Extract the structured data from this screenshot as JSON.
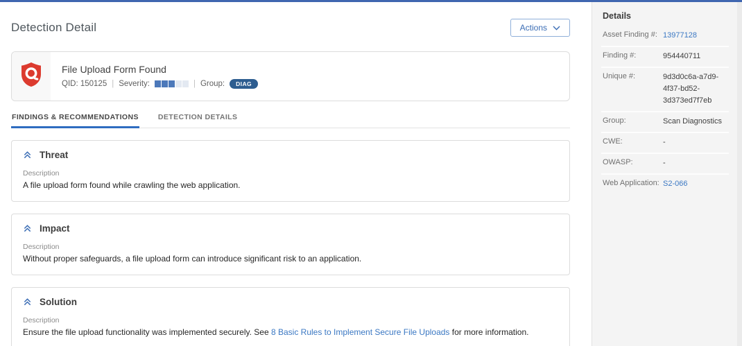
{
  "colors": {
    "accent": "#2f6cc0",
    "accent_dark": "#3f66b0",
    "severity_filled": "#4d79ba",
    "badge": "#2d5d90",
    "link": "#3b78c3",
    "logo_red": "#dc3b2f"
  },
  "page": {
    "title": "Detection Detail",
    "actions_label": "Actions"
  },
  "finding_header": {
    "title": "File Upload Form Found",
    "qid_label": "QID:",
    "qid_value": "150125",
    "severity_label": "Severity:",
    "severity_filled": 3,
    "severity_total": 5,
    "group_label": "Group:",
    "group_badge": "DIAG",
    "separator": "|"
  },
  "tabs": [
    {
      "label": "FINDINGS & RECOMMENDATIONS",
      "active": true
    },
    {
      "label": "DETECTION DETAILS",
      "active": false
    }
  ],
  "sections": [
    {
      "title": "Threat",
      "description_label": "Description",
      "body": "A file upload form found while crawling the web application."
    },
    {
      "title": "Impact",
      "description_label": "Description",
      "body": "Without proper safeguards, a file upload form can introduce significant risk to an application."
    },
    {
      "title": "Solution",
      "description_label": "Description",
      "body_prefix": "Ensure the file upload functionality was implemented securely. See ",
      "body_link": "8 Basic Rules to Implement Secure File Uploads",
      "body_suffix": " for more information."
    }
  ],
  "details_panel": {
    "title": "Details",
    "rows": [
      {
        "label": "Asset Finding #:",
        "value": "13977128",
        "link": true
      },
      {
        "label": "Finding #:",
        "value": "954440711",
        "link": false
      },
      {
        "label": "Unique #:",
        "value": "9d3d0c6a-a7d9-4f37-bd52-3d373ed7f7eb",
        "link": false
      },
      {
        "label": "Group:",
        "value": "Scan Diagnostics",
        "link": false
      },
      {
        "label": "CWE:",
        "value": "-",
        "link": false
      },
      {
        "label": "OWASP:",
        "value": "-",
        "link": false
      },
      {
        "label": "Web Application:",
        "value": "S2-066",
        "link": true
      }
    ]
  }
}
